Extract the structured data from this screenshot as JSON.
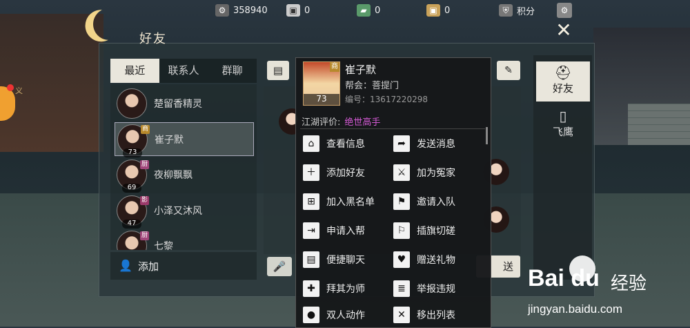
{
  "topbar": {
    "resources": [
      {
        "icon": "gear-coin-icon",
        "value": "358940"
      },
      {
        "icon": "gift-box-icon",
        "value": "0"
      },
      {
        "icon": "green-ticket-icon",
        "value": "0"
      },
      {
        "icon": "gold-box-icon",
        "value": "0"
      },
      {
        "icon": "shield-points-icon",
        "value": "积分"
      }
    ]
  },
  "panel": {
    "title": "好友",
    "close": "✕"
  },
  "tabs": [
    "最近",
    "联系人",
    "群聊"
  ],
  "friends": [
    {
      "name": "楚留香精灵",
      "level": "",
      "badge": ""
    },
    {
      "name": "崔子默",
      "level": "73",
      "badge": "商",
      "badge_color": "#b7892c"
    },
    {
      "name": "夜柳飘飘",
      "level": "69",
      "badge": "厨",
      "badge_color": "#a0467a"
    },
    {
      "name": "小泽又沐风",
      "level": "47",
      "badge": "影",
      "badge_color": "#9b3a6a"
    },
    {
      "name": "七黎",
      "level": "",
      "badge": "厨",
      "badge_color": "#a0467a"
    }
  ],
  "add_label": "添加",
  "side_tabs": [
    "好友",
    "飞鹰"
  ],
  "send_label": "送",
  "left_side_text": "义",
  "popup": {
    "name": "崔子默",
    "level": "73",
    "badge": "商",
    "guild": "帮会：菩提门",
    "id": "编号：13617220298",
    "eval_label": "江湖评价:",
    "eval_value": "绝世高手",
    "actions": [
      {
        "icon": "view-info-icon",
        "label": "查看信息"
      },
      {
        "icon": "send-message-icon",
        "label": "发送消息"
      },
      {
        "icon": "add-friend-icon",
        "label": "添加好友"
      },
      {
        "icon": "add-enemy-icon",
        "label": "加为冤家"
      },
      {
        "icon": "blacklist-icon",
        "label": "加入黑名单"
      },
      {
        "icon": "invite-team-icon",
        "label": "邀请入队"
      },
      {
        "icon": "join-guild-icon",
        "label": "申请入帮"
      },
      {
        "icon": "duel-flag-icon",
        "label": "插旗切磋"
      },
      {
        "icon": "quick-chat-icon",
        "label": "便捷聊天"
      },
      {
        "icon": "gift-icon",
        "label": "赠送礼物"
      },
      {
        "icon": "apprentice-icon",
        "label": "拜其为师"
      },
      {
        "icon": "report-icon",
        "label": "举报违规"
      },
      {
        "icon": "double-action-icon",
        "label": "双人动作"
      },
      {
        "icon": "remove-list-icon",
        "label": "移出列表"
      }
    ]
  },
  "watermark": {
    "brand": "Bai du",
    "cn": "经验",
    "url": "jingyan.baidu.com"
  }
}
